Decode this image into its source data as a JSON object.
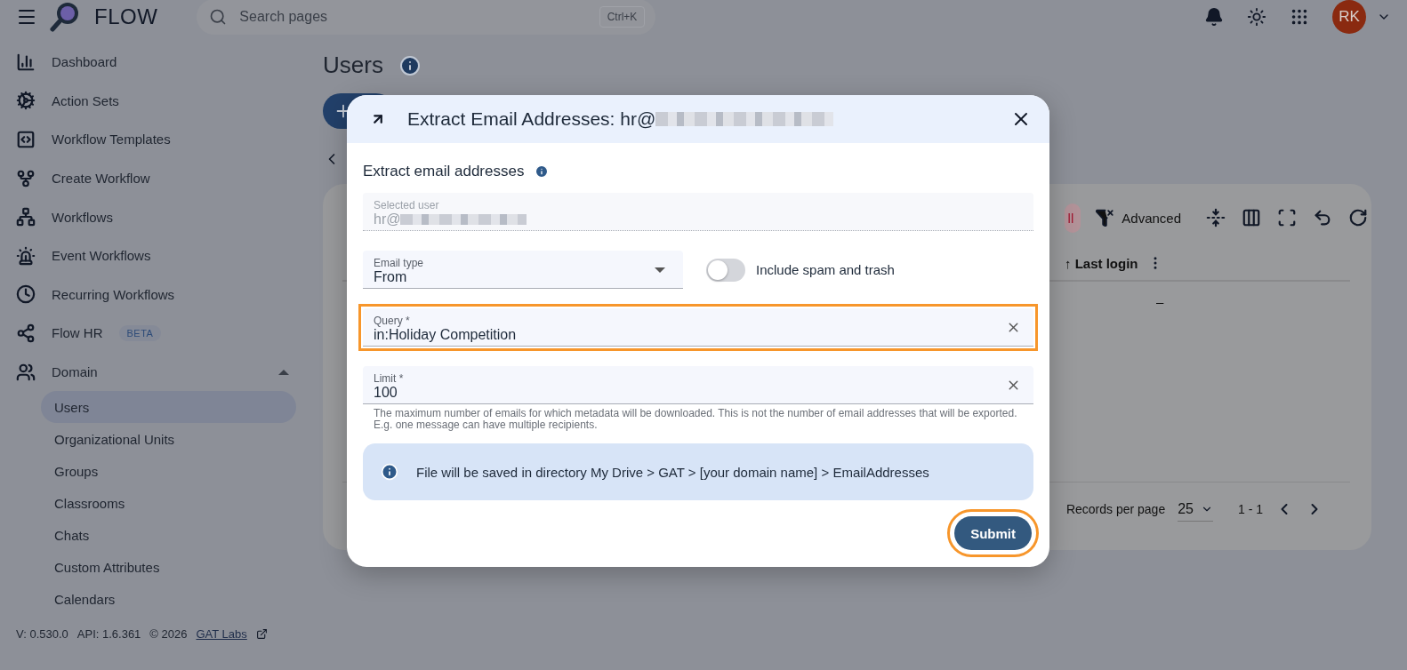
{
  "header": {
    "brand": "FLOW",
    "search": {
      "placeholder": "Search pages",
      "shortcut": "Ctrl+K"
    },
    "avatar": "RK"
  },
  "sidebar": {
    "items": [
      {
        "label": "Dashboard",
        "selected": false
      },
      {
        "label": "Action Sets",
        "selected": false
      },
      {
        "label": "Workflow Templates",
        "selected": false
      },
      {
        "label": "Create Workflow",
        "selected": false
      },
      {
        "label": "Workflows",
        "selected": false
      },
      {
        "label": "Event Workflows",
        "selected": false
      },
      {
        "label": "Recurring Workflows",
        "selected": false
      },
      {
        "label": "Flow HR",
        "badge": "BETA",
        "selected": false
      },
      {
        "label": "Domain",
        "selected": false,
        "expanded": true,
        "children": [
          {
            "label": "Users",
            "selected": true
          },
          {
            "label": "Organizational Units",
            "selected": false
          },
          {
            "label": "Groups",
            "selected": false
          },
          {
            "label": "Classrooms",
            "selected": false
          },
          {
            "label": "Chats",
            "selected": false
          },
          {
            "label": "Custom Attributes",
            "selected": false
          },
          {
            "label": "Calendars",
            "selected": false
          }
        ]
      }
    ],
    "footer": {
      "version": "V: 0.530.0",
      "api": "API: 1.6.361",
      "copyright": "© 2026",
      "link": "GAT Labs"
    }
  },
  "page": {
    "title": "Users",
    "toolbar": {
      "chip": "ll",
      "advanced": "Advanced"
    },
    "table": {
      "columns": [
        "↑ Last login"
      ],
      "rows": [
        [
          "–"
        ]
      ]
    },
    "pagination": {
      "label": "Records per page",
      "per_page": "25",
      "range": "1 - 1"
    }
  },
  "dialog": {
    "title": "Extract Email Addresses: hr@",
    "section": "Extract email addresses",
    "fields": [
      {
        "kind": "text",
        "label": "Selected user",
        "value": "hr@",
        "redacted": true,
        "disabled": true,
        "highlighted": false
      },
      {
        "kind": "select",
        "label": "Email type",
        "value": "From",
        "disabled": false,
        "highlighted": false
      },
      {
        "kind": "toggle",
        "label": "Include spam and trash",
        "on": false
      },
      {
        "kind": "text",
        "label": "Query *",
        "value": "in:Holiday Competition",
        "clearable": true,
        "disabled": false,
        "highlighted": true
      },
      {
        "kind": "text",
        "label": "Limit *",
        "value": "100",
        "clearable": true,
        "disabled": false,
        "highlighted": false,
        "helper": "The maximum number of emails for which metadata will be downloaded. This is not the number of email addresses that will be exported. E.g. one message can have multiple recipients."
      }
    ],
    "alert": "File will be saved in directory My Drive > GAT > [your domain name] > EmailAddresses",
    "submit": {
      "label": "Submit",
      "highlighted": true
    }
  }
}
